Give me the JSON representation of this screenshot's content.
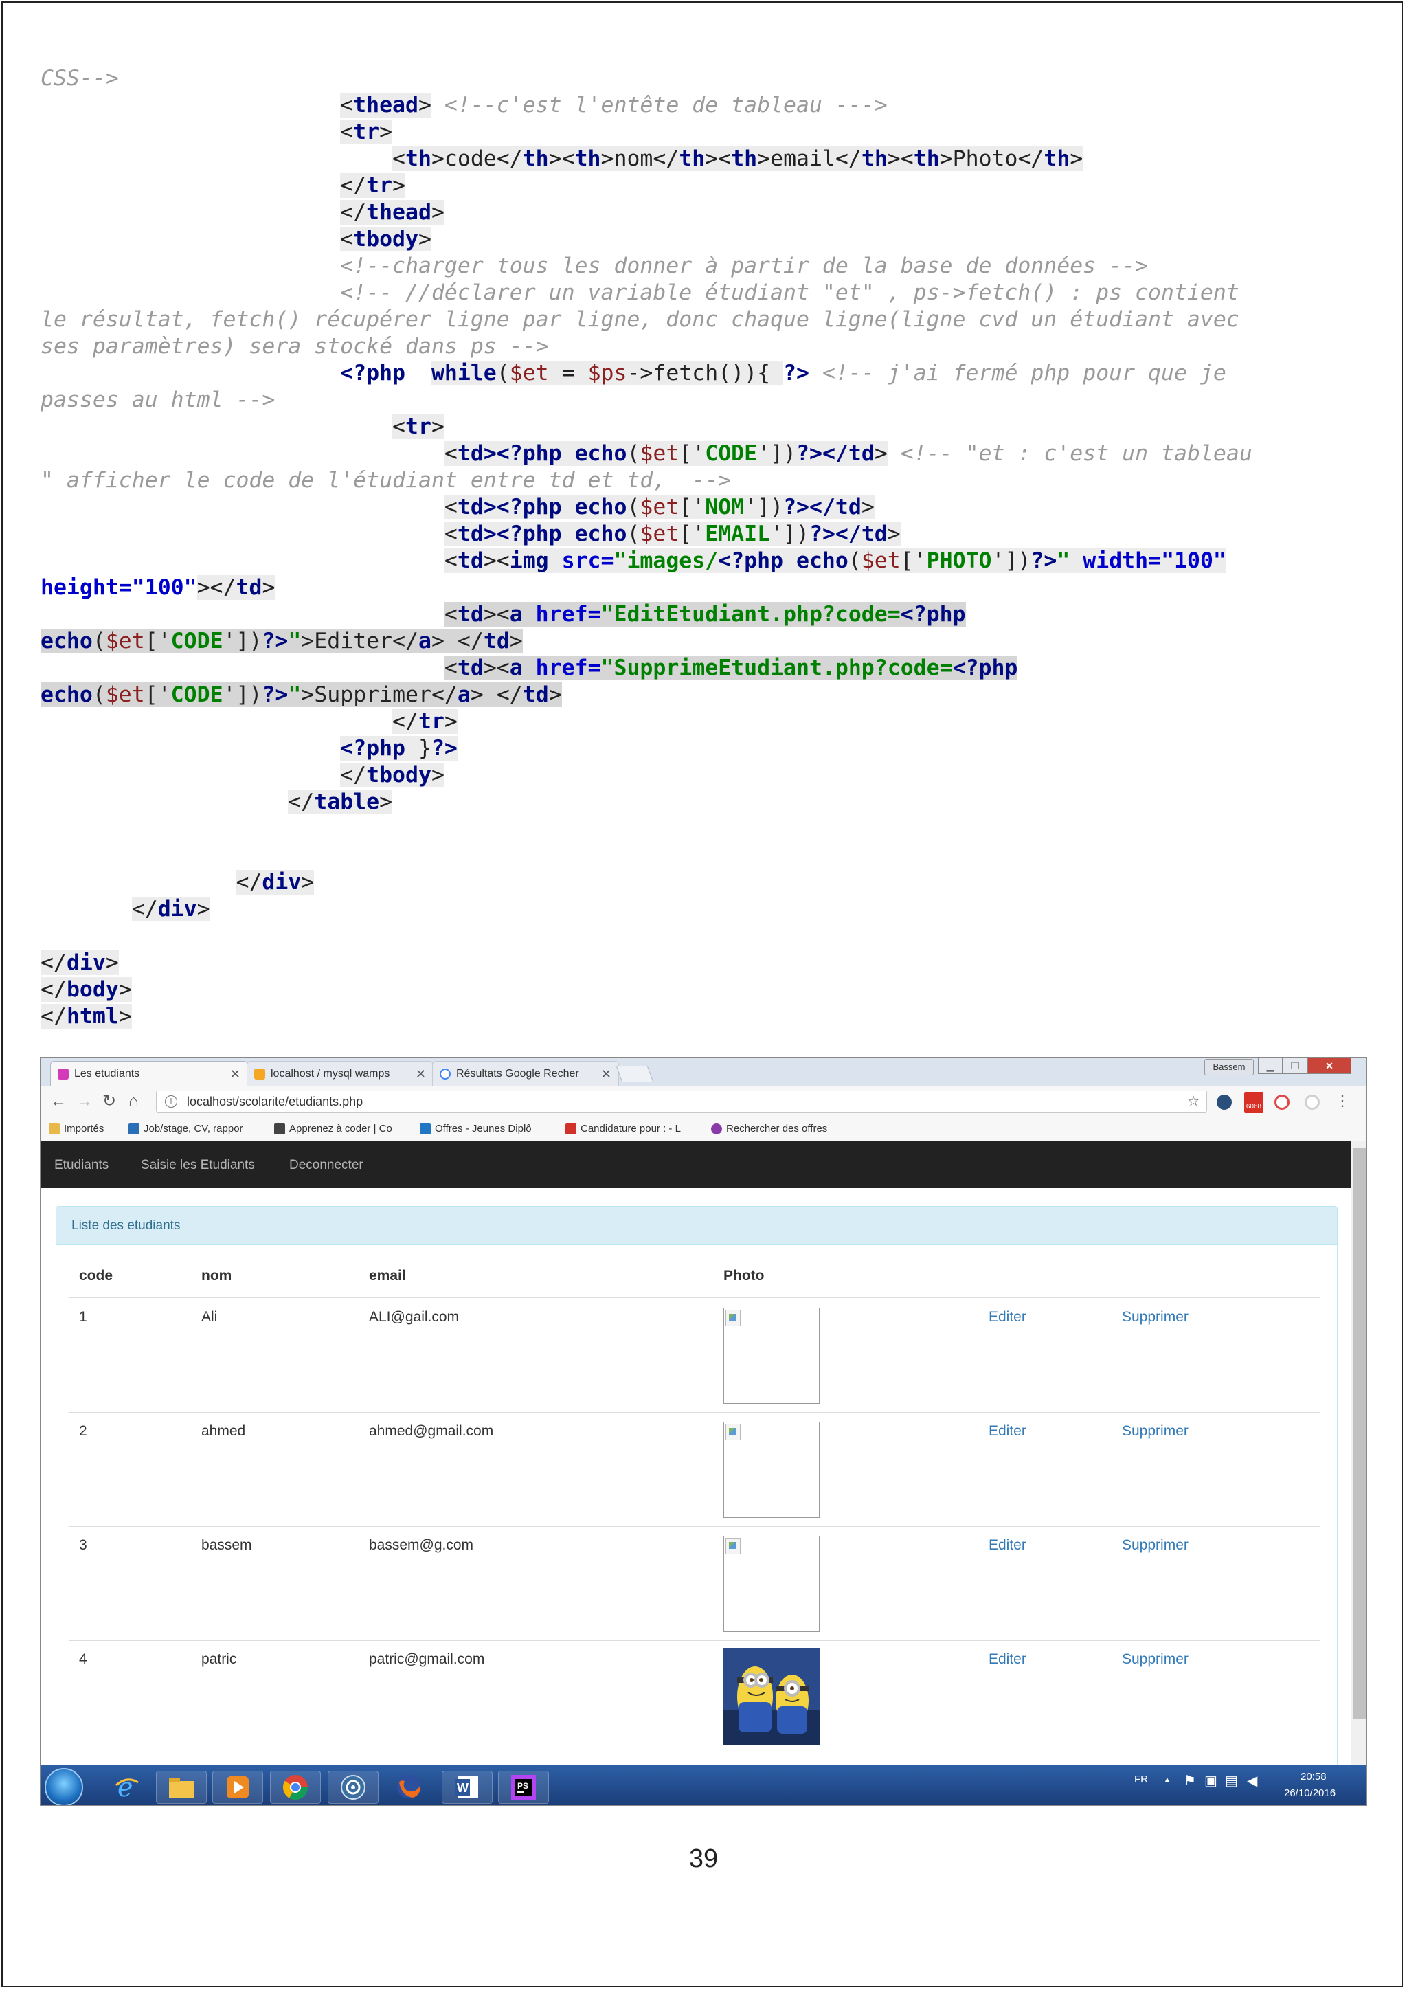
{
  "code_lines": [
    {
      "segs": [
        [
          "CSS-->",
          "cm"
        ]
      ]
    },
    {
      "segs": [
        [
          "                       ",
          ""
        ],
        [
          "<",
          "hl"
        ],
        [
          "thead",
          "kw hl"
        ],
        [
          ">",
          "hl"
        ],
        [
          " <!--c'est l'entête de tableau --->",
          "cm"
        ]
      ]
    },
    {
      "segs": [
        [
          "                       ",
          ""
        ],
        [
          "<",
          "hl"
        ],
        [
          "tr",
          "kw hl"
        ],
        [
          ">",
          "hl"
        ]
      ]
    },
    {
      "segs": [
        [
          "                           ",
          ""
        ],
        [
          "<",
          "hl"
        ],
        [
          "th",
          "kw hl"
        ],
        [
          ">code</",
          "hl"
        ],
        [
          "th",
          "kw hl"
        ],
        [
          "><",
          "hl"
        ],
        [
          "th",
          "kw hl"
        ],
        [
          ">nom</",
          "hl"
        ],
        [
          "th",
          "kw hl"
        ],
        [
          "><",
          "hl"
        ],
        [
          "th",
          "kw hl"
        ],
        [
          ">email</",
          "hl"
        ],
        [
          "th",
          "kw hl"
        ],
        [
          "><",
          "hl"
        ],
        [
          "th",
          "kw hl"
        ],
        [
          ">Photo</",
          "hl"
        ],
        [
          "th",
          "kw hl"
        ],
        [
          ">",
          "hl"
        ]
      ]
    },
    {
      "segs": [
        [
          "                       ",
          ""
        ],
        [
          "</",
          "hl"
        ],
        [
          "tr",
          "kw hl"
        ],
        [
          ">",
          "hl"
        ]
      ]
    },
    {
      "segs": [
        [
          "                       ",
          ""
        ],
        [
          "</",
          "hl"
        ],
        [
          "thead",
          "kw hl"
        ],
        [
          ">",
          "hl"
        ]
      ]
    },
    {
      "segs": [
        [
          "                       ",
          ""
        ],
        [
          "<",
          "hl"
        ],
        [
          "tbody",
          "kw hl"
        ],
        [
          ">",
          "hl"
        ]
      ]
    },
    {
      "segs": [
        [
          "                       ",
          ""
        ],
        [
          "<!--charger tous les donner à partir de la base de données -->",
          "cm"
        ]
      ]
    },
    {
      "segs": [
        [
          "                       ",
          ""
        ],
        [
          "<!-- //déclarer un variable étudiant \"et\" , ps->fetch() : ps contient",
          "cm"
        ]
      ]
    },
    {
      "segs": [
        [
          "le résultat, fetch() récupérer ligne par ligne, donc chaque ligne(ligne cvd un étudiant avec",
          "cm"
        ]
      ]
    },
    {
      "segs": [
        [
          "ses paramètres) sera stocké dans ps -->",
          "cm"
        ]
      ]
    },
    {
      "segs": [
        [
          "                       ",
          ""
        ],
        [
          "<?php",
          "kw"
        ],
        [
          "  ",
          ""
        ],
        [
          "while",
          "kw hl"
        ],
        [
          "(",
          "hl"
        ],
        [
          "$et",
          "ph hl"
        ],
        [
          " = ",
          "hl"
        ],
        [
          "$ps",
          "ph hl"
        ],
        [
          "->fetch()){ ",
          "hl"
        ],
        [
          "?>",
          "kw"
        ],
        [
          " <!-- j'ai fermé php pour que je",
          "cm"
        ]
      ]
    },
    {
      "segs": [
        [
          "passes au html -->",
          "cm"
        ]
      ]
    },
    {
      "segs": [
        [
          "                           ",
          ""
        ],
        [
          "<",
          "hl"
        ],
        [
          "tr",
          "kw hl"
        ],
        [
          ">",
          "hl"
        ]
      ]
    },
    {
      "segs": [
        [
          "                               ",
          ""
        ],
        [
          "<",
          "hl"
        ],
        [
          "td",
          "kw hl"
        ],
        [
          "><?php ",
          "kw hl"
        ],
        [
          "echo",
          "kw hl"
        ],
        [
          "(",
          "hl"
        ],
        [
          "$et",
          "ph hl"
        ],
        [
          "['",
          "hl"
        ],
        [
          "CODE",
          "str hl"
        ],
        [
          "'])",
          "hl"
        ],
        [
          "?></",
          "kw hl"
        ],
        [
          "td",
          "kw hl"
        ],
        [
          ">",
          "hl"
        ],
        [
          " <!-- \"et : c'est un tableau",
          "cm"
        ]
      ]
    },
    {
      "segs": [
        [
          "\" afficher le code de l'étudiant entre td et td,  -->",
          "cm"
        ]
      ]
    },
    {
      "segs": [
        [
          "                               ",
          ""
        ],
        [
          "<",
          "hl"
        ],
        [
          "td",
          "kw hl"
        ],
        [
          "><?php ",
          "kw hl"
        ],
        [
          "echo",
          "kw hl"
        ],
        [
          "(",
          "hl"
        ],
        [
          "$et",
          "ph hl"
        ],
        [
          "['",
          "hl"
        ],
        [
          "NOM",
          "str hl"
        ],
        [
          "'])",
          "hl"
        ],
        [
          "?></",
          "kw hl"
        ],
        [
          "td",
          "kw hl"
        ],
        [
          ">",
          "hl"
        ]
      ]
    },
    {
      "segs": [
        [
          "                               ",
          ""
        ],
        [
          "<",
          "hl"
        ],
        [
          "td",
          "kw hl"
        ],
        [
          "><?php ",
          "kw hl"
        ],
        [
          "echo",
          "kw hl"
        ],
        [
          "(",
          "hl"
        ],
        [
          "$et",
          "ph hl"
        ],
        [
          "['",
          "hl"
        ],
        [
          "EMAIL",
          "str hl"
        ],
        [
          "'])",
          "hl"
        ],
        [
          "?></",
          "kw hl"
        ],
        [
          "td",
          "kw hl"
        ],
        [
          ">",
          "hl"
        ]
      ]
    },
    {
      "segs": [
        [
          "                               ",
          ""
        ],
        [
          "<",
          "hl"
        ],
        [
          "td",
          "kw hl"
        ],
        [
          "><",
          "hl"
        ],
        [
          "img",
          "kw hl"
        ],
        [
          " src=",
          "at hl"
        ],
        [
          "\"images/",
          "str hl"
        ],
        [
          "<?php ",
          "kw hl"
        ],
        [
          "echo",
          "kw hl"
        ],
        [
          "(",
          "hl"
        ],
        [
          "$et",
          "ph hl"
        ],
        [
          "['",
          "hl"
        ],
        [
          "PHOTO",
          "str hl"
        ],
        [
          "'])",
          "hl"
        ],
        [
          "?>",
          "kw hl"
        ],
        [
          "\"",
          "str hl"
        ],
        [
          " width=",
          "at hl"
        ],
        [
          "\"100\"",
          "at hl"
        ]
      ]
    },
    {
      "segs": [
        [
          "height=",
          "at"
        ],
        [
          "\"100\"",
          "at"
        ],
        [
          "></",
          "hl"
        ],
        [
          "td",
          "kw hl"
        ],
        [
          ">",
          "hl"
        ]
      ]
    },
    {
      "segs": [
        [
          "                               ",
          ""
        ],
        [
          "<",
          "hl2"
        ],
        [
          "td",
          "kw hl2"
        ],
        [
          "><",
          "hl2"
        ],
        [
          "a",
          "kw hl2"
        ],
        [
          " href=",
          "at hl2"
        ],
        [
          "\"EditEtudiant.php?code=",
          "str hl2"
        ],
        [
          "<?php",
          "kw hl2"
        ]
      ]
    },
    {
      "segs": [
        [
          "echo",
          "kw hl2"
        ],
        [
          "(",
          "hl2"
        ],
        [
          "$et",
          "ph hl2"
        ],
        [
          "['",
          "hl2"
        ],
        [
          "CODE",
          "str hl2"
        ],
        [
          "'])",
          "hl2"
        ],
        [
          "?>",
          "kw hl2"
        ],
        [
          "\"",
          "str hl2"
        ],
        [
          ">Editer</",
          "hl2"
        ],
        [
          "a",
          "kw hl2"
        ],
        [
          "> </",
          "hl2"
        ],
        [
          "td",
          "kw hl2"
        ],
        [
          ">",
          "hl2"
        ]
      ]
    },
    {
      "segs": [
        [
          "                               ",
          ""
        ],
        [
          "<",
          "hl2"
        ],
        [
          "td",
          "kw hl2"
        ],
        [
          "><",
          "hl2"
        ],
        [
          "a",
          "kw hl2"
        ],
        [
          " href=",
          "at hl2"
        ],
        [
          "\"SupprimeEtudiant.php?code=",
          "str hl2"
        ],
        [
          "<?php",
          "kw hl2"
        ]
      ]
    },
    {
      "segs": [
        [
          "echo",
          "kw hl2"
        ],
        [
          "(",
          "hl2"
        ],
        [
          "$et",
          "ph hl2"
        ],
        [
          "['",
          "hl2"
        ],
        [
          "CODE",
          "str hl2"
        ],
        [
          "'])",
          "hl2"
        ],
        [
          "?>",
          "kw hl2"
        ],
        [
          "\"",
          "str hl2"
        ],
        [
          ">Supprimer</",
          "hl2"
        ],
        [
          "a",
          "kw hl2"
        ],
        [
          "> </",
          "hl2"
        ],
        [
          "td",
          "kw hl2"
        ],
        [
          ">",
          "hl2"
        ]
      ]
    },
    {
      "segs": [
        [
          "                           ",
          ""
        ],
        [
          "</",
          "hl"
        ],
        [
          "tr",
          "kw hl"
        ],
        [
          ">",
          "hl"
        ]
      ]
    },
    {
      "segs": [
        [
          "                       ",
          ""
        ],
        [
          "<?php",
          "kw hl"
        ],
        [
          " }",
          "hl"
        ],
        [
          "?>",
          "kw hl"
        ]
      ]
    },
    {
      "segs": [
        [
          "                       ",
          ""
        ],
        [
          "</",
          "hl"
        ],
        [
          "tbody",
          "kw hl"
        ],
        [
          ">",
          "hl"
        ]
      ]
    },
    {
      "segs": [
        [
          "                   ",
          ""
        ],
        [
          "</",
          "hl"
        ],
        [
          "table",
          "kw hl"
        ],
        [
          ">",
          "hl"
        ]
      ]
    },
    {
      "segs": [
        [
          "",
          ""
        ]
      ]
    },
    {
      "segs": [
        [
          "",
          ""
        ]
      ]
    },
    {
      "segs": [
        [
          "               ",
          ""
        ],
        [
          "</",
          "hl"
        ],
        [
          "div",
          "kw hl"
        ],
        [
          ">",
          "hl"
        ]
      ]
    },
    {
      "segs": [
        [
          "       ",
          ""
        ],
        [
          "</",
          "hl"
        ],
        [
          "div",
          "kw hl"
        ],
        [
          ">",
          "hl"
        ]
      ]
    },
    {
      "segs": [
        [
          "",
          ""
        ]
      ]
    },
    {
      "segs": [
        [
          "</",
          "hl"
        ],
        [
          "div",
          "kw hl"
        ],
        [
          ">",
          "hl"
        ]
      ]
    },
    {
      "segs": [
        [
          "</",
          "hl"
        ],
        [
          "body",
          "kw hl"
        ],
        [
          ">",
          "hl"
        ]
      ]
    },
    {
      "segs": [
        [
          "</",
          "hl"
        ],
        [
          "html",
          "kw hl"
        ],
        [
          ">",
          "hl"
        ]
      ]
    }
  ],
  "browser": {
    "tabs": [
      {
        "label": "Les etudiants",
        "icon": "app-icon",
        "color": "#d23ab8"
      },
      {
        "label": "localhost / mysql wamps",
        "icon": "phpmyadmin-icon",
        "color": "#f5a623"
      },
      {
        "label": "Résultats Google Recher",
        "icon": "google-icon",
        "color": "#4285f4"
      }
    ],
    "user_badge": "Bassem",
    "url": "localhost/scolarite/etudiants.php",
    "bookmarks": [
      {
        "label": "Importés",
        "color": "#e8b84a"
      },
      {
        "label": "Job/stage, CV, rappor",
        "color": "#2a6fb5"
      },
      {
        "label": "Apprenez à coder | Co",
        "color": "#444444"
      },
      {
        "label": "Offres - Jeunes Diplô",
        "color": "#1f76c2"
      },
      {
        "label": "Candidature pour : - L",
        "color": "#d0322b"
      },
      {
        "label": "Rechercher des offres",
        "color": "#8a3aa8"
      }
    ],
    "gmail_count": "6068",
    "nav": [
      "Etudiants",
      "Saisie les Etudiants",
      "Deconnecter"
    ],
    "panel_title": "Liste des etudiants",
    "columns": [
      "code",
      "nom",
      "email",
      "Photo"
    ],
    "rows": [
      {
        "code": "1",
        "nom": "Ali",
        "email": "ALI@gail.com",
        "photo": "broken",
        "edit": "Editer",
        "delete": "Supprimer"
      },
      {
        "code": "2",
        "nom": "ahmed",
        "email": "ahmed@gmail.com",
        "photo": "broken",
        "edit": "Editer",
        "delete": "Supprimer"
      },
      {
        "code": "3",
        "nom": "bassem",
        "email": "bassem@g.com",
        "photo": "broken",
        "edit": "Editer",
        "delete": "Supprimer"
      },
      {
        "code": "4",
        "nom": "patric",
        "email": "patric@gmail.com",
        "photo": "minions",
        "edit": "Editer",
        "delete": "Supprimer"
      }
    ],
    "taskbar": {
      "lang": "FR",
      "time": "20:58",
      "date": "26/10/2016",
      "word_label": "W",
      "ps_label": "PS"
    }
  },
  "page_number": "39"
}
